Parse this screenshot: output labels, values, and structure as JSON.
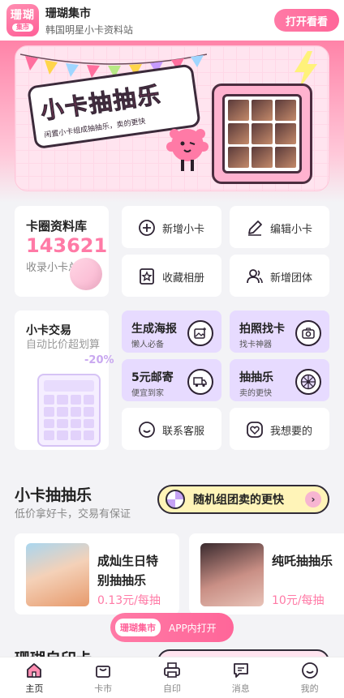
{
  "app": {
    "logo_line1": "珊瑚",
    "logo_line2": "集市",
    "name": "珊瑚集市",
    "subtitle": "韩国明星小卡资料站",
    "open_button": "打开看看"
  },
  "banner": {
    "title": "小卡抽抽乐",
    "tagline": "闲置小卡组成抽抽乐，卖的更快"
  },
  "stats": {
    "label": "卡圈资料库",
    "count": "143621",
    "caption": "收录小卡总数"
  },
  "actions": [
    {
      "label": "新增小卡",
      "icon": "plus-circle-icon"
    },
    {
      "label": "编辑小卡",
      "icon": "pen-icon"
    },
    {
      "label": "收藏相册",
      "icon": "star-album-icon"
    },
    {
      "label": "新增团体",
      "icon": "group-icon"
    }
  ],
  "trade": {
    "title": "小卡交易",
    "desc": "自动比价超划算",
    "discount": "-20%"
  },
  "tiles": [
    {
      "title": "生成海报",
      "sub": "懒人必备",
      "icon": "image-plus-icon"
    },
    {
      "title": "拍照找卡",
      "sub": "找卡神器",
      "icon": "camera-icon"
    },
    {
      "title": "5元邮寄",
      "sub": "便宜到家",
      "icon": "truck-icon"
    },
    {
      "title": "抽抽乐",
      "sub": "卖的更快",
      "icon": "wheel-icon"
    }
  ],
  "service": [
    {
      "label": "联系客服",
      "icon": "chat-icon"
    },
    {
      "label": "我想要的",
      "icon": "heart-icon"
    }
  ],
  "section": {
    "title": "小卡抽抽乐",
    "subtitle": "低价拿好卡，交易有保证",
    "button": "随机组团卖的更快",
    "arrow": "›"
  },
  "products": [
    {
      "name_line1": "成灿生日特",
      "name_line2": "别抽抽乐",
      "price": "0.13元/每抽"
    },
    {
      "name_line1": "纯吒抽抽乐",
      "name_line2": "",
      "price": "10元/每抽"
    }
  ],
  "float_pill": {
    "tag": "珊瑚集市",
    "text": "APP内打开"
  },
  "section2": {
    "title": "珊瑚自印卡"
  },
  "nav": [
    {
      "label": "主页",
      "icon": "home-icon",
      "active": true
    },
    {
      "label": "卡市",
      "icon": "bag-icon",
      "active": false
    },
    {
      "label": "自印",
      "icon": "printer-icon",
      "active": false
    },
    {
      "label": "消息",
      "icon": "message-icon",
      "active": false
    },
    {
      "label": "我的",
      "icon": "smile-icon",
      "active": false
    }
  ],
  "colors": {
    "brand_pink": "#ff6699",
    "lavender": "#e7dbff",
    "price_pink": "#ff7aa6"
  }
}
